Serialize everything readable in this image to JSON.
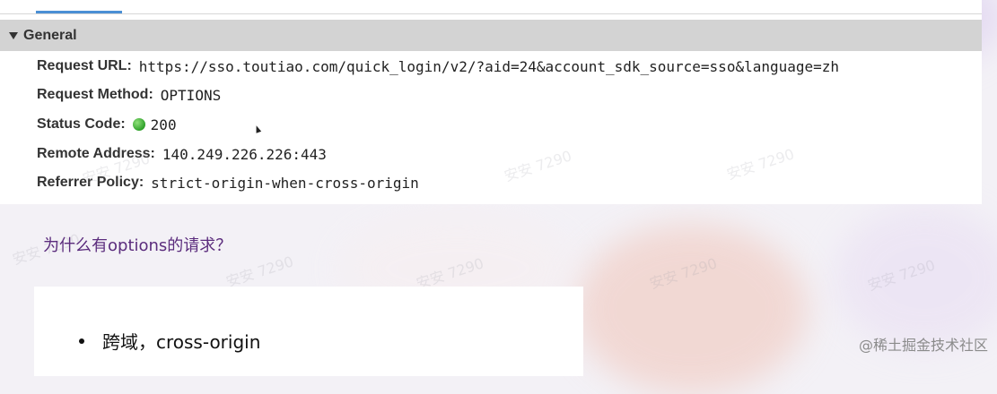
{
  "general": {
    "title": "General",
    "fields": [
      {
        "key": "Request URL:",
        "value": "https://sso.toutiao.com/quick_login/v2/?aid=24&account_sdk_source=sso&language=zh"
      },
      {
        "key": "Request Method:",
        "value": "OPTIONS"
      },
      {
        "key": "Status Code:",
        "value": "200",
        "status_color": "#2fa12a"
      },
      {
        "key": "Remote Address:",
        "value": "140.249.226.226:443"
      },
      {
        "key": "Referrer Policy:",
        "value": "strict-origin-when-cross-origin"
      }
    ]
  },
  "slide": {
    "question": "为什么有options的请求？",
    "bullets": [
      "跨域，cross-origin"
    ]
  },
  "watermark_text": "安安 7290",
  "footer_watermark": "@稀土掘金技术社区",
  "colors": {
    "header_bar": "#d3d3d3",
    "tab_accent": "#4a8fd4",
    "question_text": "#5b2c7d"
  }
}
